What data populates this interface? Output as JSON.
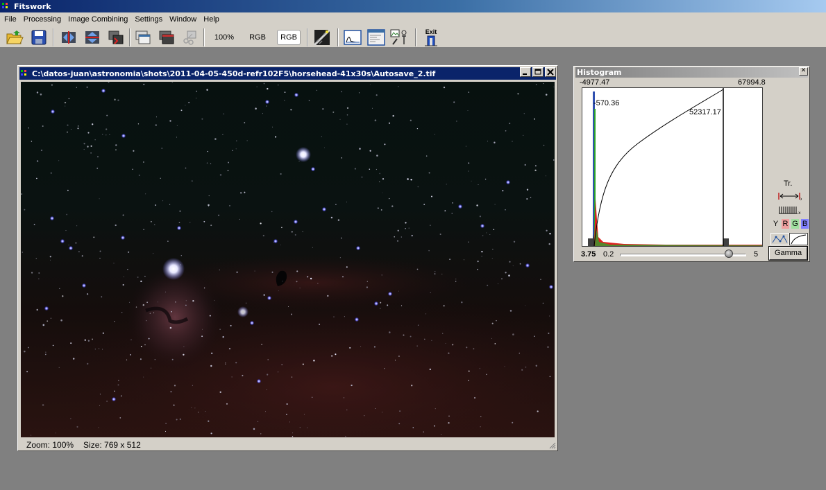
{
  "app": {
    "title": "Fitswork"
  },
  "menu": [
    "File",
    "Processing",
    "Image Combining",
    "Settings",
    "Window",
    "Help"
  ],
  "toolbar": {
    "zoom_label": "100%",
    "rgb_label": "RGB",
    "rgb_active_label": "RGB",
    "exit_label": "Exit",
    "icons": [
      "open-folder-icon",
      "save-icon",
      "flip-horizontal-icon",
      "flip-vertical-icon",
      "rotate-icon",
      "copy-window-icon",
      "window-icon",
      "cut-icon",
      "zoom-100",
      "rgb-toggle",
      "rgb-active",
      "grid-pattern-icon",
      "histogram-icon",
      "image-info-icon",
      "color-tools-icon",
      "exit-icon"
    ]
  },
  "image_window": {
    "title": "C:\\datos-juan\\astronomia\\shots\\2011-04-05-450d-refr102F5\\horsehead-41x30s\\Autosave_2.tif",
    "zoom_text": "Zoom: 100%",
    "size_text": "Size: 769 x 512"
  },
  "histogram": {
    "title": "Histogram",
    "min_label": "-4977.47",
    "max_label": "67994.8",
    "black_point_label": "-570.36",
    "white_point_label": "52317.17",
    "gamma_value": "3.75",
    "slider_min": "0.2",
    "slider_max": "5",
    "slider_position": 0.86,
    "tr_label": "Tr.",
    "channels": [
      "Y",
      "R",
      "G",
      "B"
    ],
    "channel_colors": {
      "R": "#f0a0a0",
      "G": "#a0e0a0",
      "B": "#8080ff"
    },
    "gamma_button": "Gamma"
  }
}
